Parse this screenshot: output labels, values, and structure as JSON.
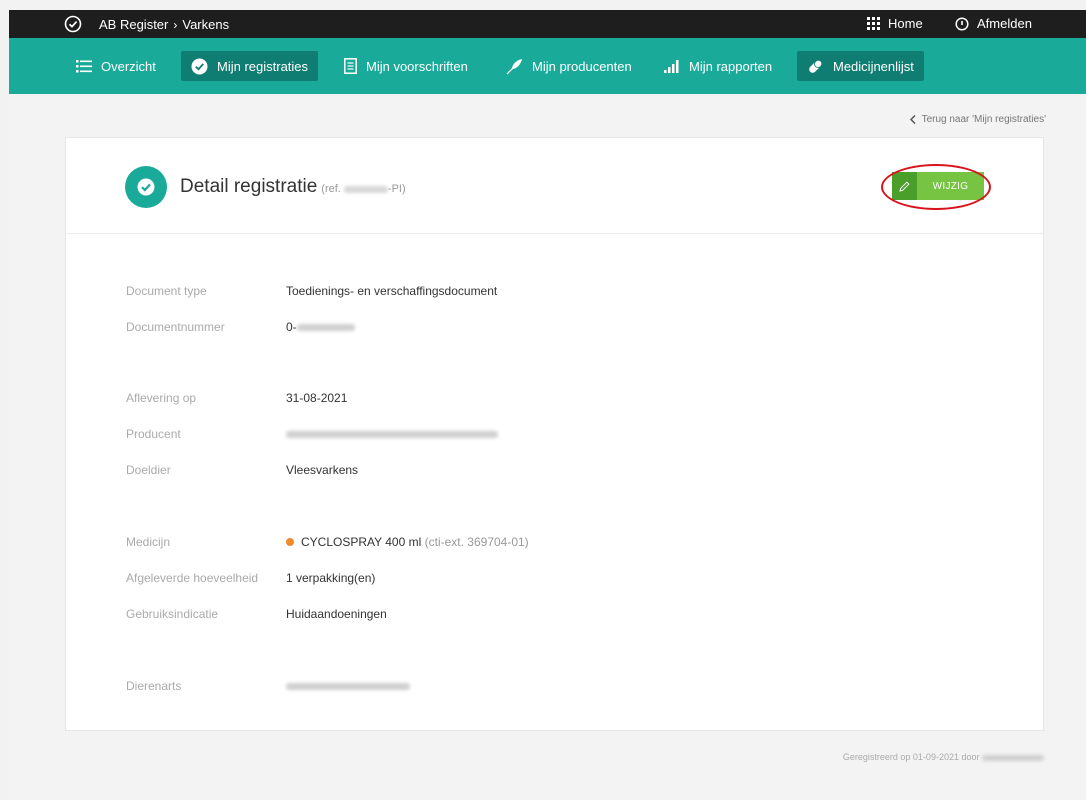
{
  "topbar": {
    "app": "AB Register",
    "separator": "›",
    "section": "Varkens",
    "home": "Home",
    "logout": "Afmelden"
  },
  "nav": {
    "items": [
      {
        "label": "Overzicht",
        "icon": "list-icon",
        "active": false
      },
      {
        "label": "Mijn registraties",
        "icon": "check-circle-icon",
        "active": true
      },
      {
        "label": "Mijn voorschriften",
        "icon": "document-icon",
        "active": false
      },
      {
        "label": "Mijn producenten",
        "icon": "feather-icon",
        "active": false
      },
      {
        "label": "Mijn rapporten",
        "icon": "bar-chart-icon",
        "active": false
      },
      {
        "label": "Medicijnenlijst",
        "icon": "pill-icon",
        "active": true
      }
    ]
  },
  "back_link": "Terug naar 'Mijn registraties'",
  "detail": {
    "title": "Detail registratie",
    "ref_prefix": "(ref.",
    "ref_suffix": "-PI)",
    "edit_label": "WIJZIG"
  },
  "fields": {
    "document_type": {
      "label": "Document type",
      "value": "Toedienings- en verschaffingsdocument"
    },
    "document_number": {
      "label": "Documentnummer",
      "value_prefix": "0-"
    },
    "delivery_date": {
      "label": "Aflevering op",
      "value": "31-08-2021"
    },
    "producer": {
      "label": "Producent"
    },
    "target_animal": {
      "label": "Doeldier",
      "value": "Vleesvarkens"
    },
    "medicine": {
      "label": "Medicijn",
      "value": "CYCLOSPRAY 400 ml",
      "extra": "(cti-ext. 369704-01)",
      "dot_color": "#f08a2c"
    },
    "quantity": {
      "label": "Afgeleverde hoeveelheid",
      "value": "1 verpakking(en)"
    },
    "indication": {
      "label": "Gebruiksindicatie",
      "value": "Huidaandoeningen"
    },
    "vet": {
      "label": "Dierenarts"
    }
  },
  "footer": {
    "registered": "Geregistreerd op 01-09-2021 door"
  },
  "colors": {
    "teal": "#19aa9a",
    "teal_active": "#0f7d71",
    "green": "#76c442",
    "highlight": "#d8131b"
  }
}
